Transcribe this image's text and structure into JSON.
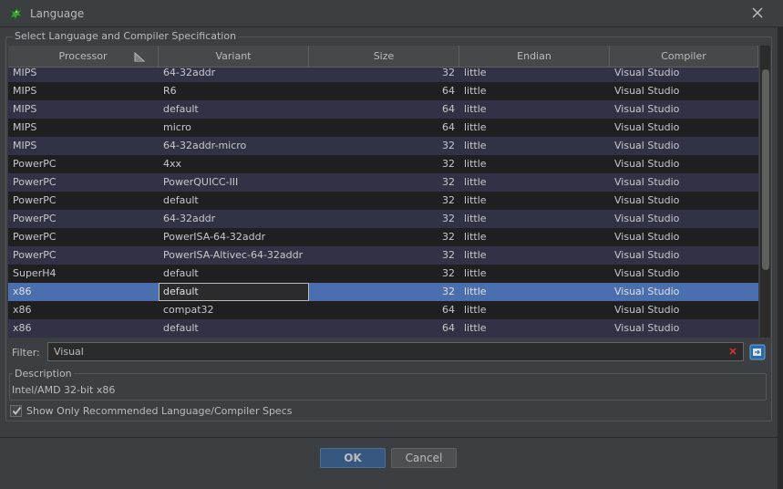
{
  "window": {
    "title": "Language",
    "icon": "dragon-icon",
    "close_icon": "close-icon"
  },
  "group": {
    "title": "Select Language and Compiler Specification"
  },
  "table": {
    "columns": [
      "Processor",
      "Variant",
      "Size",
      "Endian",
      "Compiler"
    ],
    "sort_icon": "sort-ascending-icon",
    "rows": [
      {
        "processor": "MIPS",
        "variant": "64-32addr",
        "size": "32",
        "endian": "little",
        "compiler": "Visual Studio"
      },
      {
        "processor": "MIPS",
        "variant": "R6",
        "size": "64",
        "endian": "little",
        "compiler": "Visual Studio"
      },
      {
        "processor": "MIPS",
        "variant": "default",
        "size": "64",
        "endian": "little",
        "compiler": "Visual Studio"
      },
      {
        "processor": "MIPS",
        "variant": "micro",
        "size": "64",
        "endian": "little",
        "compiler": "Visual Studio"
      },
      {
        "processor": "MIPS",
        "variant": "64-32addr-micro",
        "size": "32",
        "endian": "little",
        "compiler": "Visual Studio"
      },
      {
        "processor": "PowerPC",
        "variant": "4xx",
        "size": "32",
        "endian": "little",
        "compiler": "Visual Studio"
      },
      {
        "processor": "PowerPC",
        "variant": "PowerQUICC-III",
        "size": "32",
        "endian": "little",
        "compiler": "Visual Studio"
      },
      {
        "processor": "PowerPC",
        "variant": "default",
        "size": "32",
        "endian": "little",
        "compiler": "Visual Studio"
      },
      {
        "processor": "PowerPC",
        "variant": "64-32addr",
        "size": "32",
        "endian": "little",
        "compiler": "Visual Studio"
      },
      {
        "processor": "PowerPC",
        "variant": "PowerISA-64-32addr",
        "size": "32",
        "endian": "little",
        "compiler": "Visual Studio"
      },
      {
        "processor": "PowerPC",
        "variant": "PowerISA-Altivec-64-32addr",
        "size": "32",
        "endian": "little",
        "compiler": "Visual Studio"
      },
      {
        "processor": "SuperH4",
        "variant": "default",
        "size": "32",
        "endian": "little",
        "compiler": "Visual Studio"
      },
      {
        "processor": "x86",
        "variant": "default",
        "size": "32",
        "endian": "little",
        "compiler": "Visual Studio"
      },
      {
        "processor": "x86",
        "variant": "compat32",
        "size": "64",
        "endian": "little",
        "compiler": "Visual Studio"
      },
      {
        "processor": "x86",
        "variant": "default",
        "size": "64",
        "endian": "little",
        "compiler": "Visual Studio"
      }
    ]
  },
  "filter": {
    "label": "Filter:",
    "value": "Visual",
    "clear_icon": "clear-icon",
    "button_icon": "filter-options-icon"
  },
  "description": {
    "title": "Description",
    "text": "Intel/AMD 32-bit x86"
  },
  "recommended": {
    "label": "Show Only Recommended Language/Compiler Specs",
    "checked": true
  },
  "buttons": {
    "ok": "OK",
    "cancel": "Cancel"
  },
  "colors": {
    "selection": "#4b6eaf",
    "row_alt": "#323246",
    "row_dark": "#1f1f22",
    "ok_button": "#365880"
  }
}
